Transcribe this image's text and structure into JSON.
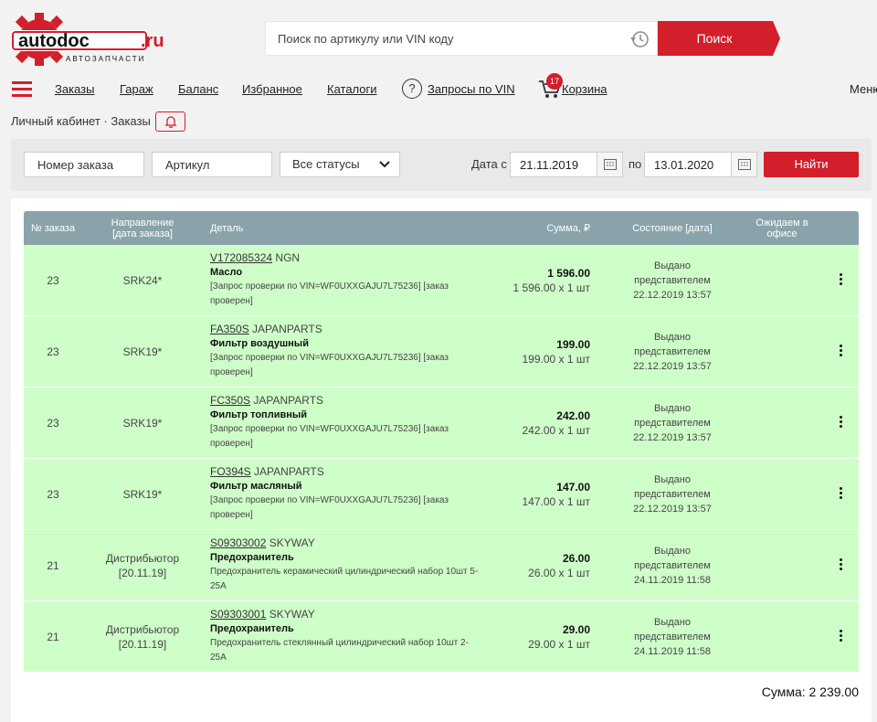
{
  "brand": {
    "logo_main": "autodoc",
    "logo_suffix": ".ru",
    "logo_tagline": "АВТОЗАПЧАСТИ",
    "accent_color": "#d31e2b",
    "row_color": "#cfffc9",
    "header_color": "#8aa3ab"
  },
  "search": {
    "placeholder": "Поиск по артикулу или VIN коду",
    "button_label": "Поиск",
    "history_icon": "history-clock-icon"
  },
  "nav": {
    "items": [
      {
        "label": "Заказы"
      },
      {
        "label": "Гараж"
      },
      {
        "label": "Баланс"
      },
      {
        "label": "Избранное"
      },
      {
        "label": "Каталоги"
      },
      {
        "label": "Запросы по VIN"
      },
      {
        "label": "Корзина"
      }
    ],
    "cart_count": "17",
    "menu_label": "Меню"
  },
  "breadcrumb": "Личный кабинет · Заказы",
  "filter": {
    "order_number_placeholder": "Номер заказа",
    "article_placeholder": "Артикул",
    "status_value": "Все статусы",
    "date_from_label": "Дата с",
    "date_from": "21.11.2019",
    "date_to_label": "по",
    "date_to": "13.01.2020",
    "find_button": "Найти"
  },
  "table": {
    "headers": {
      "num": "№ заказа",
      "direction": "Направление [дата заказа]",
      "part": "Деталь",
      "sum": "Сумма, ₽",
      "state": "Состояние [дата]",
      "office": "Ожидаем в офисе"
    },
    "rows": [
      {
        "num": "23",
        "direction": "SRK24*",
        "code": "V172085324",
        "brand": "NGN",
        "name": "Масло",
        "note": "[Запрос проверки по VIN=WF0UXXGAJU7L75236] [заказ проверен]",
        "total": "1 596.00",
        "unit": "1 596.00 x 1 шт",
        "state": "Выдано представителем 22.12.2019 13:57"
      },
      {
        "num": "23",
        "direction": "SRK19*",
        "code": "FA350S",
        "brand": "JAPANPARTS",
        "name": "Фильтр воздушный",
        "note": "[Запрос проверки по VIN=WF0UXXGAJU7L75236] [заказ проверен]",
        "total": "199.00",
        "unit": "199.00 x 1 шт",
        "state": "Выдано представителем 22.12.2019 13:57"
      },
      {
        "num": "23",
        "direction": "SRK19*",
        "code": "FC350S",
        "brand": "JAPANPARTS",
        "name": "Фильтр топливный",
        "note": "[Запрос проверки по VIN=WF0UXXGAJU7L75236] [заказ проверен]",
        "total": "242.00",
        "unit": "242.00 x 1 шт",
        "state": "Выдано представителем 22.12.2019 13:57"
      },
      {
        "num": "23",
        "direction": "SRK19*",
        "code": "FO394S",
        "brand": "JAPANPARTS",
        "name": "Фильтр масляный",
        "note": "[Запрос проверки по VIN=WF0UXXGAJU7L75236] [заказ проверен]",
        "total": "147.00",
        "unit": "147.00 x 1 шт",
        "state": "Выдано представителем 22.12.2019 13:57"
      },
      {
        "num": "21",
        "direction": "Дистрибьютор [20.11.19]",
        "code": "S09303002",
        "brand": "SKYWAY",
        "name": "Предохранитель",
        "note": "Предохранитель керамический цилиндрический набор 10шт 5-25А",
        "total": "26.00",
        "unit": "26.00 x 1 шт",
        "state": "Выдано представителем 24.11.2019 11:58"
      },
      {
        "num": "21",
        "direction": "Дистрибьютор [20.11.19]",
        "code": "S09303001",
        "brand": "SKYWAY",
        "name": "Предохранитель",
        "note": "Предохранитель стеклянный цилиндрический набор 10шт 2-25А",
        "total": "29.00",
        "unit": "29.00 x 1 шт",
        "state": "Выдано представителем 24.11.2019 11:58"
      }
    ],
    "grand_total": "Сумма: 2 239.00"
  }
}
